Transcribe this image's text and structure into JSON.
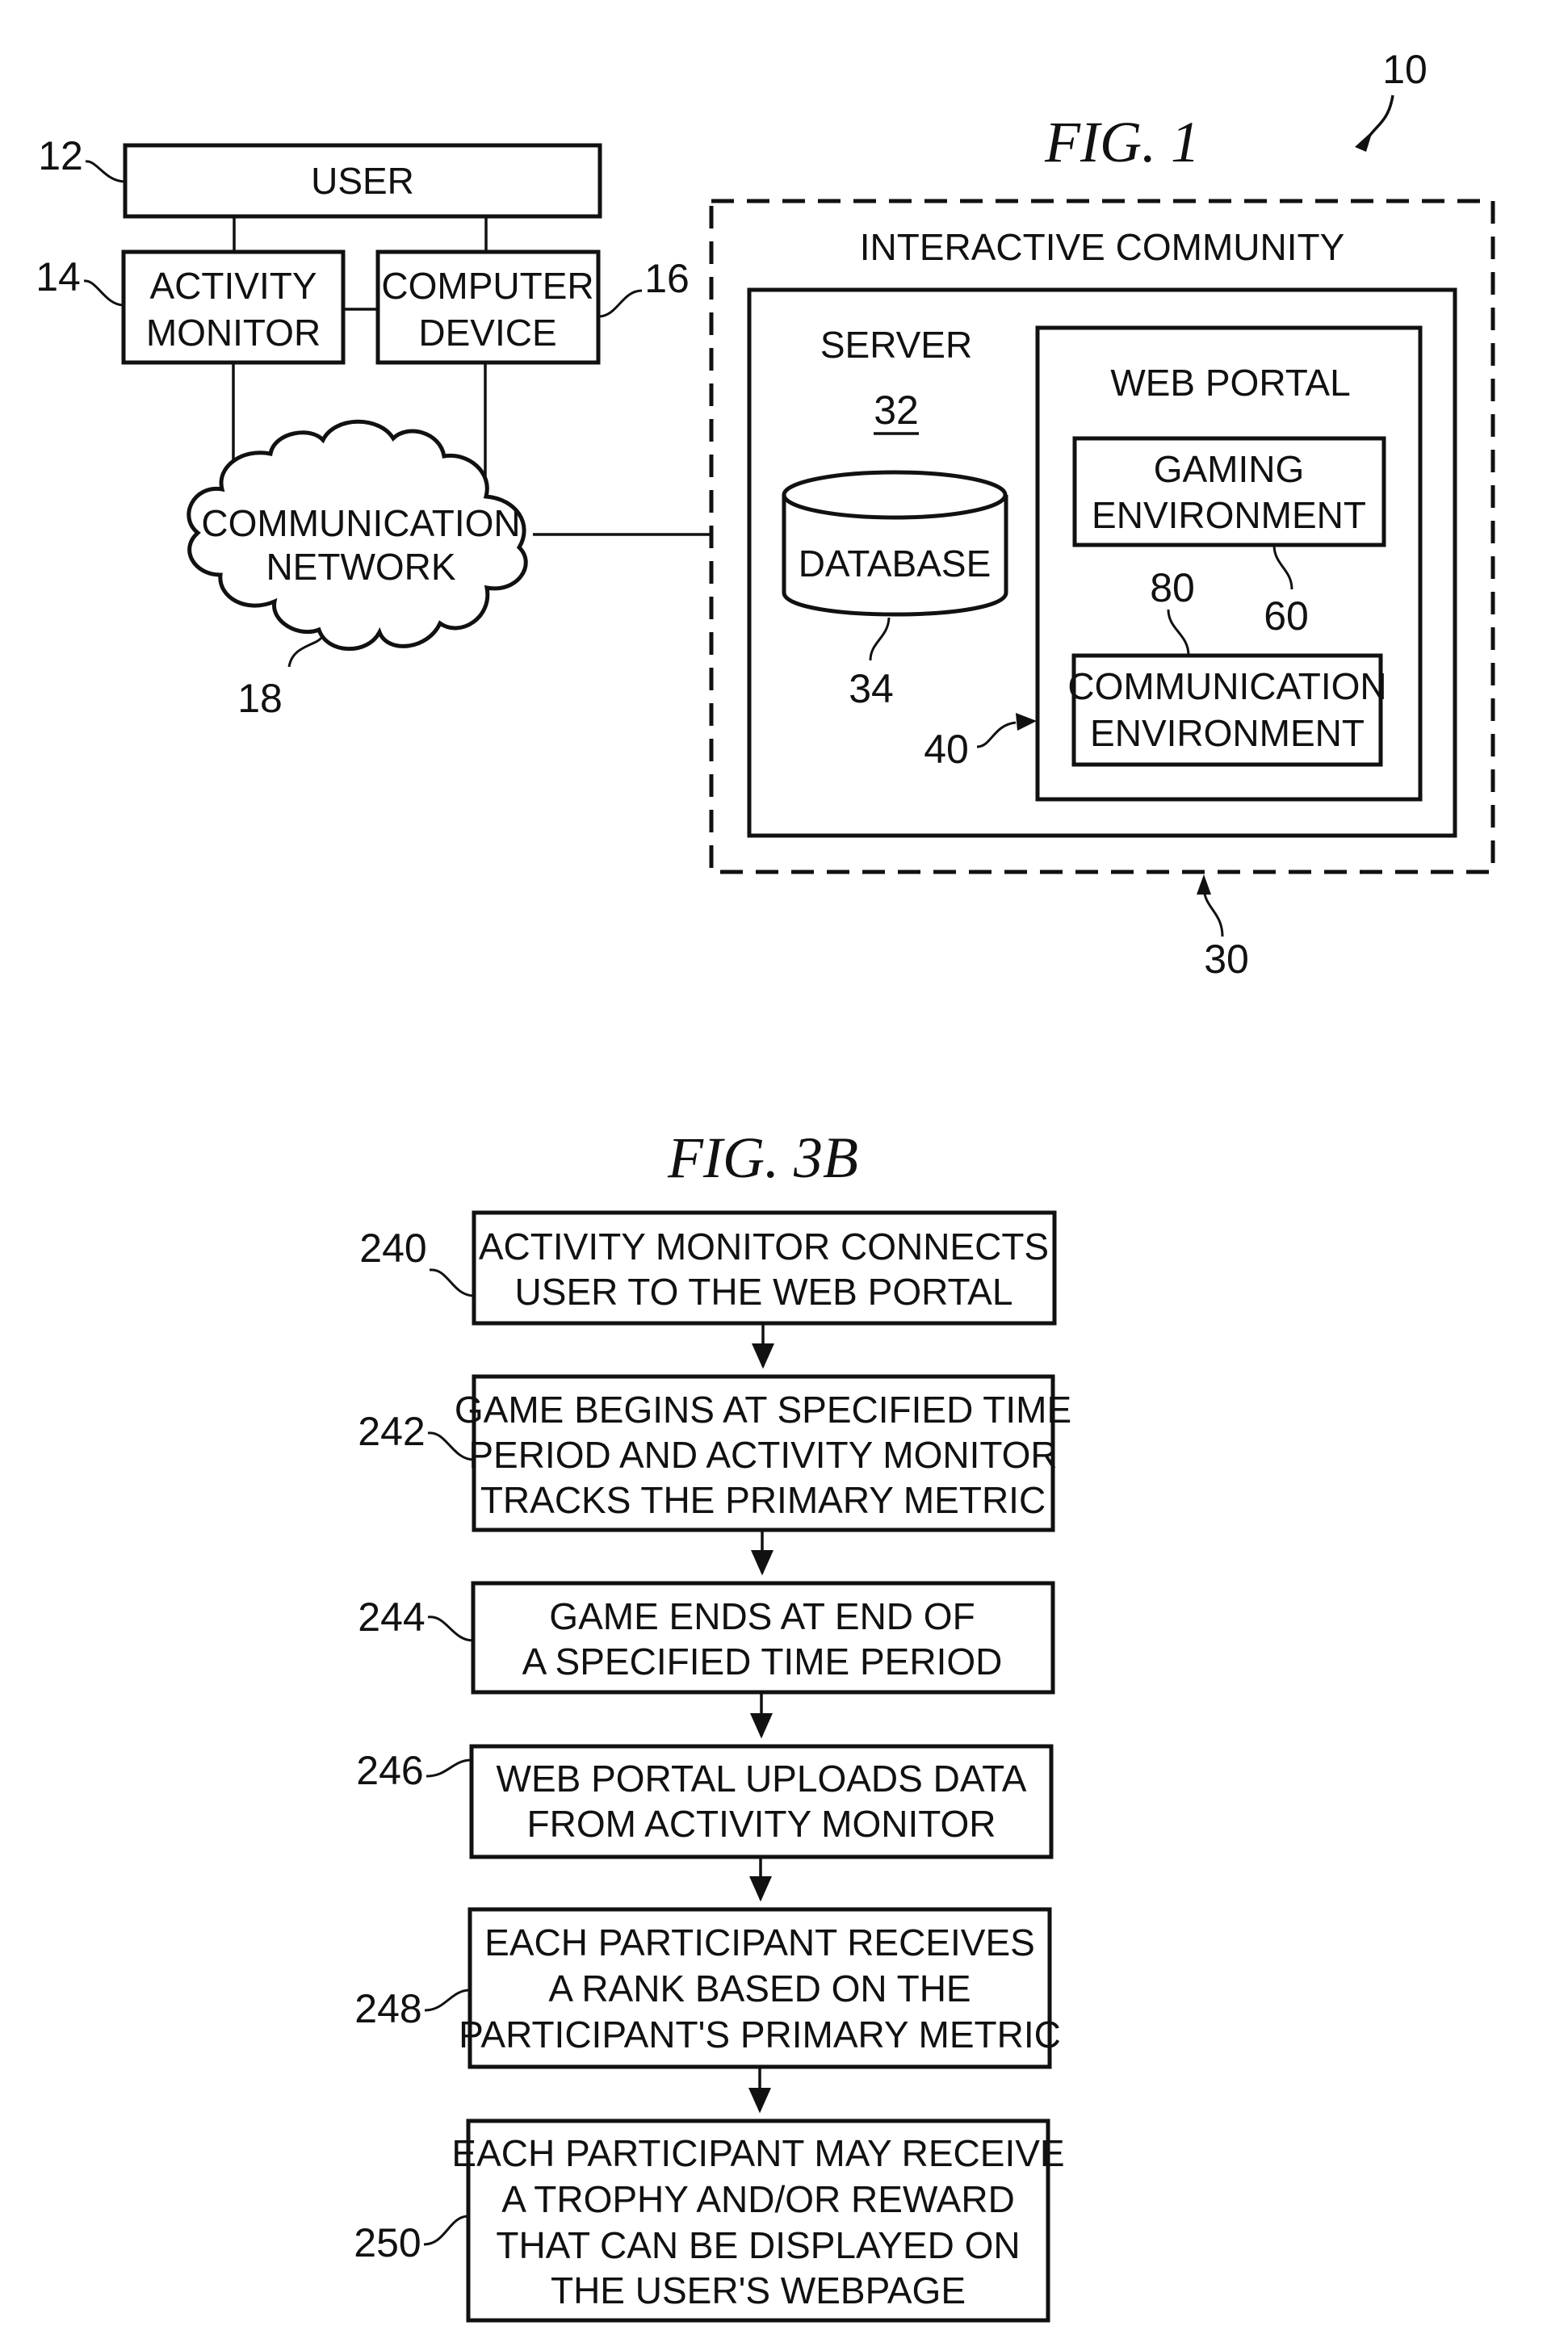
{
  "fig1": {
    "title": "FIG. 1",
    "system_ref": "10",
    "user": {
      "label": "USER",
      "ref": "12"
    },
    "activity_monitor": {
      "lines": [
        "ACTIVITY",
        "MONITOR"
      ],
      "ref": "14"
    },
    "computer_device": {
      "lines": [
        "COMPUTER",
        "DEVICE"
      ],
      "ref": "16"
    },
    "network": {
      "lines": [
        "COMMUNICATION",
        "NETWORK"
      ],
      "ref": "18"
    },
    "interactive_community": {
      "label": "INTERACTIVE COMMUNITY",
      "ref": "30"
    },
    "server": {
      "label": "SERVER",
      "ref": "32"
    },
    "database": {
      "label": "DATABASE",
      "ref": "34"
    },
    "web_portal": {
      "label": "WEB PORTAL",
      "ref": "40"
    },
    "gaming_environment": {
      "lines": [
        "GAMING",
        "ENVIRONMENT"
      ],
      "ref": "60"
    },
    "communication_environment": {
      "lines": [
        "COMMUNICATION",
        "ENVIRONMENT"
      ],
      "ref": "80"
    }
  },
  "fig3b": {
    "title": "FIG. 3B",
    "steps": [
      {
        "ref": "240",
        "lines": [
          "ACTIVITY MONITOR CONNECTS",
          "USER TO THE WEB PORTAL"
        ]
      },
      {
        "ref": "242",
        "lines": [
          "GAME BEGINS AT SPECIFIED TIME",
          "PERIOD AND ACTIVITY MONITOR",
          "TRACKS THE PRIMARY METRIC"
        ]
      },
      {
        "ref": "244",
        "lines": [
          "GAME ENDS AT END OF",
          "A SPECIFIED TIME PERIOD"
        ]
      },
      {
        "ref": "246",
        "lines": [
          "WEB PORTAL UPLOADS DATA",
          "FROM ACTIVITY MONITOR"
        ]
      },
      {
        "ref": "248",
        "lines": [
          "EACH PARTICIPANT RECEIVES",
          "A RANK BASED ON THE",
          "PARTICIPANT'S PRIMARY METRIC"
        ]
      },
      {
        "ref": "250",
        "lines": [
          "EACH PARTICIPANT MAY RECEIVE",
          "A TROPHY AND/OR REWARD",
          "THAT CAN BE DISPLAYED ON",
          "THE USER'S WEBPAGE"
        ]
      }
    ]
  }
}
